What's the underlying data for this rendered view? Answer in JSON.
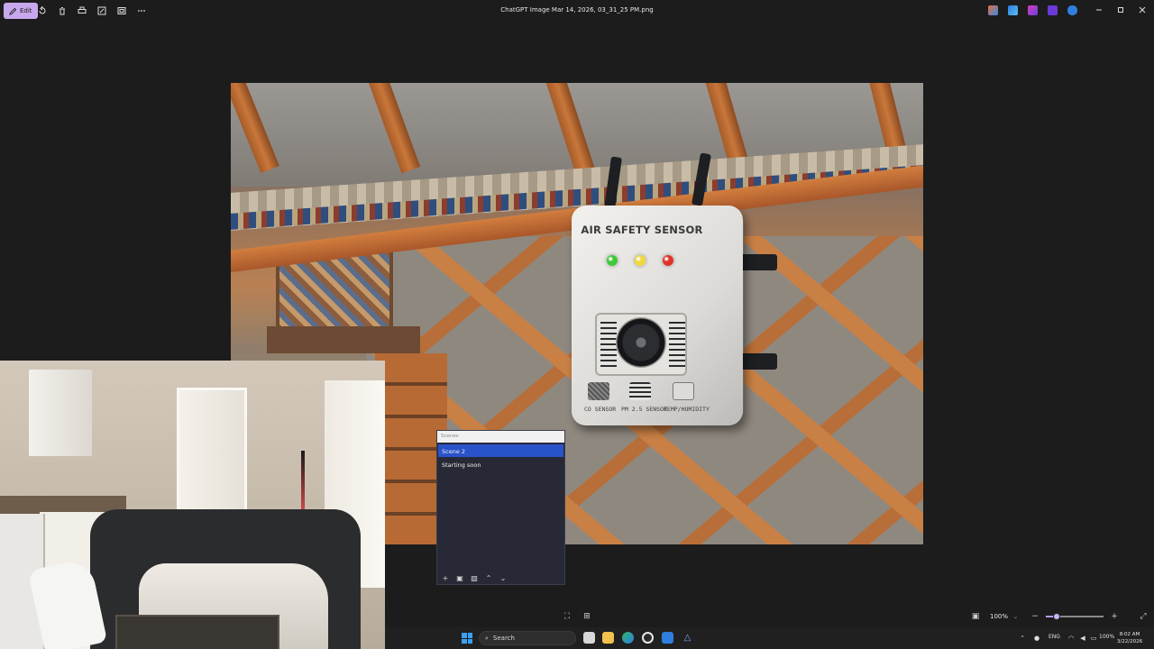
{
  "toolbar": {
    "edit_label": "Edit",
    "tools": [
      "rotate-icon",
      "delete-icon",
      "print-icon",
      "edit-image-icon",
      "view-icon",
      "more-icon"
    ]
  },
  "window": {
    "title": "ChatGPT Image Mar 14, 2026, 03_31_25 PM.png",
    "tray_apps": [
      "app-1-icon",
      "app-2-icon",
      "app-3-icon",
      "app-4-icon",
      "onedrive-icon"
    ]
  },
  "device": {
    "title": "AIR SAFETY SENSOR",
    "leds": [
      {
        "name": "green-led",
        "color": "#3fc83a"
      },
      {
        "name": "yellow-led",
        "color": "#f2d93a"
      },
      {
        "name": "red-led",
        "color": "#e0342a"
      }
    ],
    "sensor_labels": [
      "CO SENSOR",
      "PM 2.5 SENSOR",
      "TEMP/HUMIDITY"
    ]
  },
  "scenes": {
    "header": "Scenes",
    "items": [
      {
        "label": "Scene 2",
        "active": true
      },
      {
        "label": "Starting soon",
        "active": false
      }
    ]
  },
  "viewer": {
    "zoom_label": "100%",
    "zoom_fraction": 0.18
  },
  "taskbar": {
    "search_placeholder": "Search",
    "language": "ENG",
    "battery": "100%",
    "time": "8:02 AM",
    "date": "3/22/2026"
  },
  "colors": {
    "accent": "#c8a7ec",
    "scene_active": "#2953c9",
    "windows_blue": "#3aa0f3"
  }
}
